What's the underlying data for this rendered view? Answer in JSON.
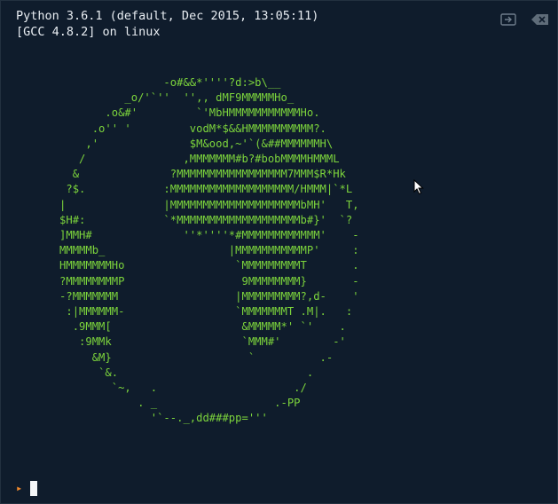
{
  "header": {
    "line1": "Python 3.6.1 (default, Dec 2015, 13:05:11)",
    "line2": "[GCC 4.8.2] on linux"
  },
  "toolbar": {
    "icons": [
      "expand-icon",
      "clear-icon"
    ]
  },
  "ascii_art": "                         -o#&&*''''?d:>b\\__\n                   _o/'`''  '',, dMF9MMMMMHo_\n                .o&#'         `'MbHMMMMMMMMMMMHo.\n              .o'' '         vodM*$&&HMMMMMMMMMM?.\n             ,'              $M&ood,~'`(&##MMMMMMH\\\n            /               ,MMMMMMM#b?#bobMMMMHMMML\n           &              ?MMMMMMMMMMMMMMMMM7MMM$R*Hk\n          ?$.            :MMMMMMMMMMMMMMMMMMM/HMMM|`*L\n         |               |MMMMMMMMMMMMMMMMMMMMbMH'   T,\n         $H#:            `*MMMMMMMMMMMMMMMMMMMb#}'  `?\n         ]MMH#              ''*''''*#MMMMMMMMMMMM'    -\n         MMMMMb_                   |MMMMMMMMMMMP'     :\n         HMMMMMMMHo                 `MMMMMMMMMT       .\n         ?MMMMMMMMP                  9MMMMMMMM}       -\n         -?MMMMMMM                  |MMMMMMMMM?,d-    '\n          :|MMMMMM-                 `MMMMMMMT .M|.   :\n           .9MMM[                    &MMMMM*' `'    .\n            :9MMk                    `MMM#'        -'\n              &M}                     `          .-\n               `&.                             .\n                 `~,   .                     ./\n                     . _                  .-PP\n                       '`--._,dd###pp='''",
  "prompt": {
    "symbol": "▸"
  },
  "colors": {
    "background": "#0f1c2c",
    "header_text": "#e8edf2",
    "art_green": "#7cd43c",
    "prompt_orange": "#f28a2c",
    "cursor": "#f4f6f8"
  }
}
